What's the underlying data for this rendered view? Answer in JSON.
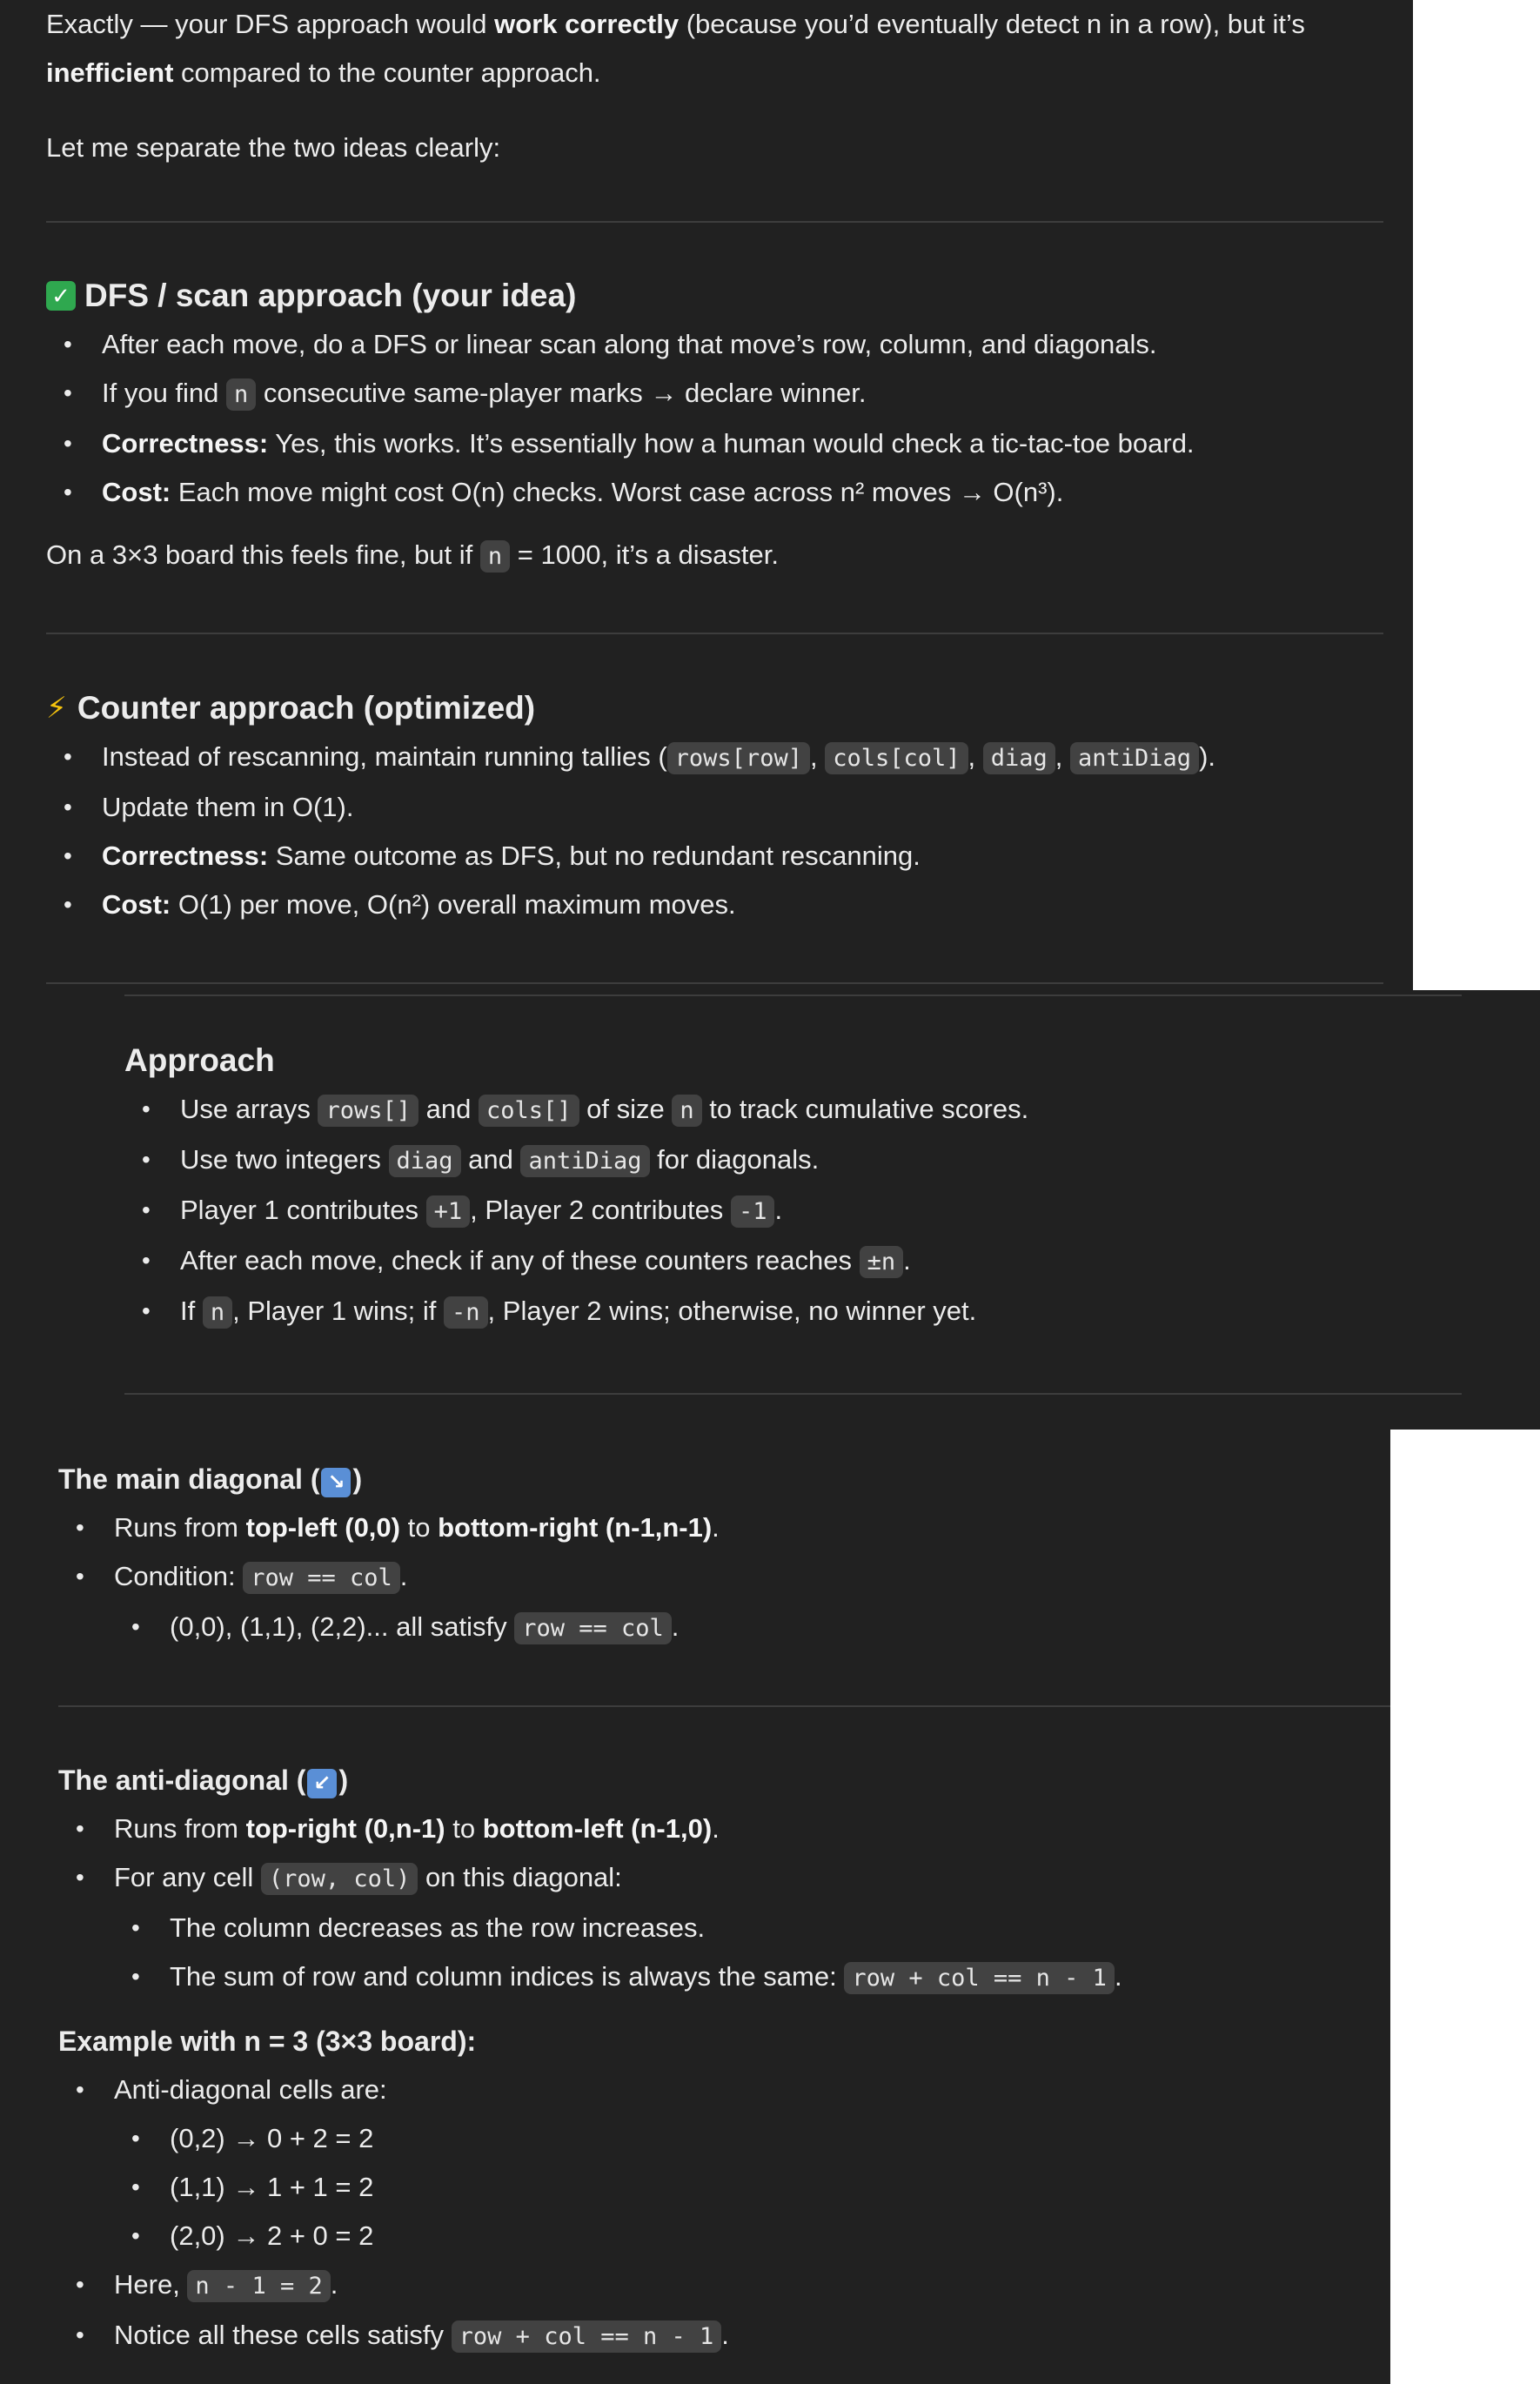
{
  "s1": {
    "intro_1a": "Exactly — your DFS approach would ",
    "intro_1b": "work correctly",
    "intro_1c": " (because you’d eventually detect n in a row), but it’s",
    "intro_2a": "inefficient",
    "intro_2b": " compared to the counter approach.",
    "separate": "Let me separate the two ideas clearly:",
    "dfs": {
      "icon": "check-mark-icon",
      "heading": "DFS / scan approach (your idea)",
      "b1": "After each move, do a DFS or linear scan along that move’s row, column, and diagonals.",
      "b2a": "If you find ",
      "b2code": "n",
      "b2b": " consecutive same-player marks → declare winner.",
      "b3label": "Correctness:",
      "b3text": " Yes, this works. It’s essentially how a human would check a tic-tac-toe board.",
      "b4label": "Cost:",
      "b4text": " Each move might cost O(n) checks. Worst case across n² moves → O(n³).",
      "note_a": "On a 3×3 board this feels fine, but if ",
      "note_code": "n",
      "note_b": " = 1000, it’s a disaster."
    },
    "counter": {
      "icon": "lightning-icon",
      "heading": "Counter approach (optimized)",
      "b1a": "Instead of rescanning, maintain running tallies (",
      "c1": "rows[row]",
      "sep": ", ",
      "c2": "cols[col]",
      "c3": "diag",
      "c4": "antiDiag",
      "b1b": ").",
      "b2": "Update them in O(1).",
      "b3label": "Correctness:",
      "b3text": " Same outcome as DFS, but no redundant rescanning.",
      "b4label": "Cost:",
      "b4text": " O(1) per move, O(n²) overall maximum moves."
    }
  },
  "s2": {
    "heading": "Approach",
    "b1a": "Use arrays ",
    "b1c1": "rows[]",
    "b1b": " and ",
    "b1c2": "cols[]",
    "b1c": " of size ",
    "b1c3": "n",
    "b1d": " to track cumulative scores.",
    "b2a": "Use two integers ",
    "b2c1": "diag",
    "b2b": " and ",
    "b2c2": "antiDiag",
    "b2c": " for diagonals.",
    "b3a": "Player 1 contributes ",
    "b3c1": "+1",
    "b3b": ", Player 2 contributes ",
    "b3c2": "-1",
    "b3c": ".",
    "b4a": "After each move, check if any of these counters reaches ",
    "b4c": "±n",
    "b4b": ".",
    "b5a": "If ",
    "b5c1": "n",
    "b5b": ", Player 1 wins; if ",
    "b5c2": "-n",
    "b5c": ", Player 2 wins; otherwise, no winner yet."
  },
  "s3": {
    "main": {
      "heading_a": "The main diagonal (",
      "icon": "arrow-down-right-icon",
      "heading_b": ")",
      "b1a": "Runs from ",
      "b1b": "top-left (0,0)",
      "b1c": " to ",
      "b1d": "bottom-right (n-1,n-1)",
      "b1e": ".",
      "b2a": "Condition: ",
      "b2c": "row == col",
      "b2b": ".",
      "sub1a": "(0,0), (1,1), (2,2)... all satisfy ",
      "sub1c": "row == col",
      "sub1b": "."
    },
    "anti": {
      "heading_a": "The anti-diagonal (",
      "icon": "arrow-down-left-icon",
      "heading_b": ")",
      "b1a": "Runs from ",
      "b1b": "top-right (0,n-1)",
      "b1c": " to ",
      "b1d": "bottom-left (n-1,0)",
      "b1e": ".",
      "b2a": "For any cell ",
      "b2c": "(row, col)",
      "b2b": " on this diagonal:",
      "sub1": "The column decreases as the row increases.",
      "sub2a": "The sum of row and column indices is always the same: ",
      "sub2c": "row + col == n - 1",
      "sub2b": "."
    },
    "example": {
      "heading": "Example with n = 3 (3×3 board):",
      "b1": "Anti-diagonal cells are:",
      "c1": "(0,2) → 0 + 2 = 2",
      "c2": "(1,1) → 1 + 1 = 2",
      "c3": "(2,0) → 2 + 0 = 2",
      "b2a": "Here, ",
      "b2c": "n - 1 = 2",
      "b2b": ".",
      "b3a": "Notice all these cells satisfy ",
      "b3c": "row + col == n - 1",
      "b3b": "."
    }
  }
}
